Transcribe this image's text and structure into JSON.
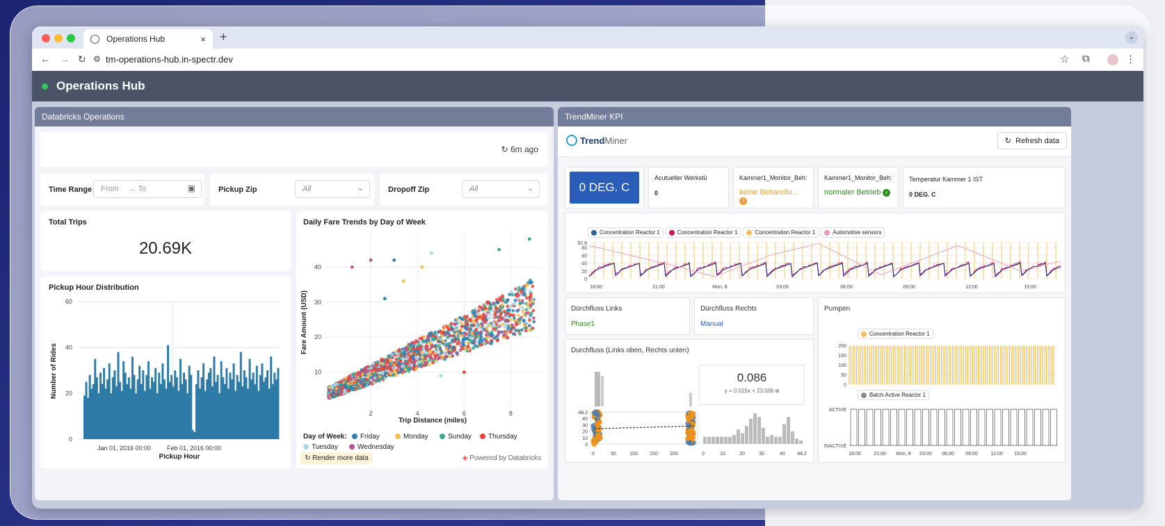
{
  "browser": {
    "tab_title": "Operations Hub",
    "tab_close": "×",
    "new_tab": "+",
    "url": "tm-operations-hub.in-spectr.dev"
  },
  "app": {
    "title": "Operations Hub"
  },
  "databricks": {
    "panel_title": "Databricks Operations",
    "refreshed": "6m ago",
    "filters": {
      "time_range_label": "Time Range",
      "from_placeholder": "From",
      "to_placeholder": "To",
      "pickup_zip_label": "Pickup Zip",
      "pickup_zip_value": "All",
      "dropoff_zip_label": "Dropoff Zip",
      "dropoff_zip_value": "All"
    },
    "total_trips_label": "Total Trips",
    "total_trips_value": "20.69K",
    "render_more": "Render more data",
    "powered_by": "Powered by Databricks"
  },
  "trendminer": {
    "panel_title": "TrendMiner KPI",
    "logo_text_bold": "Trend",
    "logo_text_light": "Miner",
    "refresh_label": "Refresh data",
    "kpis": [
      {
        "title": "",
        "value": "0 DEG. C"
      },
      {
        "title": "Acutueller Werkstü",
        "value": "0"
      },
      {
        "title": "Kammer1_Monitor_Beh:",
        "value": "keine Behandlu..."
      },
      {
        "title": "Kammer1_Monitor_Beh:",
        "value": "normaler Betrieb"
      },
      {
        "title": "Temperatur Kammer 1 IST",
        "value": "0 DEG. C"
      }
    ],
    "trend_legend": [
      "Concentration Reactor 1",
      "Concentration Reactor 1",
      "Concentration Reactor 1",
      "Automotive sensors"
    ],
    "durchfluss_links_title": "Dürchfluss Links",
    "durchfluss_links_value": "Phase1",
    "durchfluss_rechts_title": "Dürchfluss Rechts",
    "durchfluss_rechts_value": "Manual",
    "durchfluss_chart_title": "Durchfluss (Links oben, Rechts unten)",
    "regression_value": "0.086",
    "regression_equation": "y = 0.015x + 23.006",
    "pumpen_title": "Pumpen",
    "pumpen_legend_1": "Concentration Reactor 1",
    "pumpen_legend_2": "Batch Active Reactor 1",
    "colors": {
      "blue": "#2a5db7",
      "orange": "#f0a030",
      "green": "#2e8b1e",
      "legend": [
        "#2f6690",
        "#c2185b",
        "#f0c060",
        "#e89ab8"
      ]
    }
  },
  "chart_data": [
    {
      "type": "bar",
      "title": "Pickup Hour Distribution",
      "xlabel": "Pickup Hour",
      "ylabel": "Number of Rides",
      "ylim": [
        0,
        60
      ],
      "yticks": [
        "0",
        "20",
        "40",
        "60"
      ],
      "xticks": [
        "Jan 01, 2016 00:00",
        "Feb 01, 2016 00:00"
      ],
      "values": [
        19,
        25,
        18,
        28,
        22,
        24,
        35,
        27,
        20,
        29,
        24,
        31,
        22,
        26,
        33,
        20,
        27,
        30,
        23,
        38,
        25,
        21,
        34,
        29,
        24,
        27,
        22,
        36,
        28,
        20,
        26,
        32,
        24,
        30,
        21,
        28,
        34,
        22,
        27,
        25,
        31,
        20,
        29,
        24,
        33,
        26,
        22,
        41,
        25,
        28,
        23,
        30,
        27,
        21,
        35,
        24,
        29,
        26,
        20,
        32,
        28,
        4,
        3,
        24,
        30,
        22,
        27,
        33,
        21,
        26,
        29,
        31,
        23,
        36,
        25,
        28,
        20,
        34,
        27,
        24,
        31,
        22,
        29,
        26,
        33,
        21,
        28,
        25,
        38,
        23,
        30,
        27,
        22,
        35,
        26,
        29,
        24,
        32,
        21,
        28,
        33,
        25,
        27,
        30,
        22,
        36,
        24,
        29,
        26,
        31
      ]
    },
    {
      "type": "scatter",
      "title": "Daily Fare Trends by Day of Week",
      "xlabel": "Trip Distance (miles)",
      "ylabel": "Fare Amount (USD)",
      "xticks": [
        "2",
        "4",
        "6",
        "8"
      ],
      "yticks": [
        "10",
        "20",
        "30",
        "40"
      ],
      "legend_title": "Day of Week:",
      "series": [
        {
          "name": "Friday",
          "color": "#2f7fb5"
        },
        {
          "name": "Monday",
          "color": "#f2c14e"
        },
        {
          "name": "Sunday",
          "color": "#3aaa8a"
        },
        {
          "name": "Thursday",
          "color": "#e8443a"
        },
        {
          "name": "Tuesday",
          "color": "#a9d6ea"
        },
        {
          "name": "Wednesday",
          "color": "#b8578a"
        }
      ]
    },
    {
      "type": "line",
      "title": "",
      "yticks": [
        "0",
        "20",
        "40",
        "60",
        "80",
        "92.8"
      ],
      "xticks": [
        "18:00",
        "21:00",
        "Mon, 8",
        "03:00",
        "06:00",
        "09:00",
        "12:00",
        "15:00"
      ]
    },
    {
      "type": "scatter",
      "title": "Durchfluss (Links oben, Rechts unten)",
      "yticks": [
        "0",
        "10",
        "20",
        "30",
        "40",
        "48.2"
      ],
      "xticks": [
        "0",
        "50",
        "100",
        "150",
        "200"
      ],
      "hist_xticks": [
        "0",
        "10",
        "20",
        "30",
        "40",
        "48.2"
      ]
    },
    {
      "type": "line",
      "title": "Pumpen",
      "yticks_top": [
        "0",
        "50",
        "100",
        "150",
        "200"
      ],
      "yticks_bottom": [
        "ACTIVE",
        "INACTIVE"
      ],
      "xticks": [
        "18:00",
        "21:00",
        "Mon, 8",
        "03:00",
        "06:00",
        "09:00",
        "12:00",
        "15:00"
      ]
    }
  ]
}
